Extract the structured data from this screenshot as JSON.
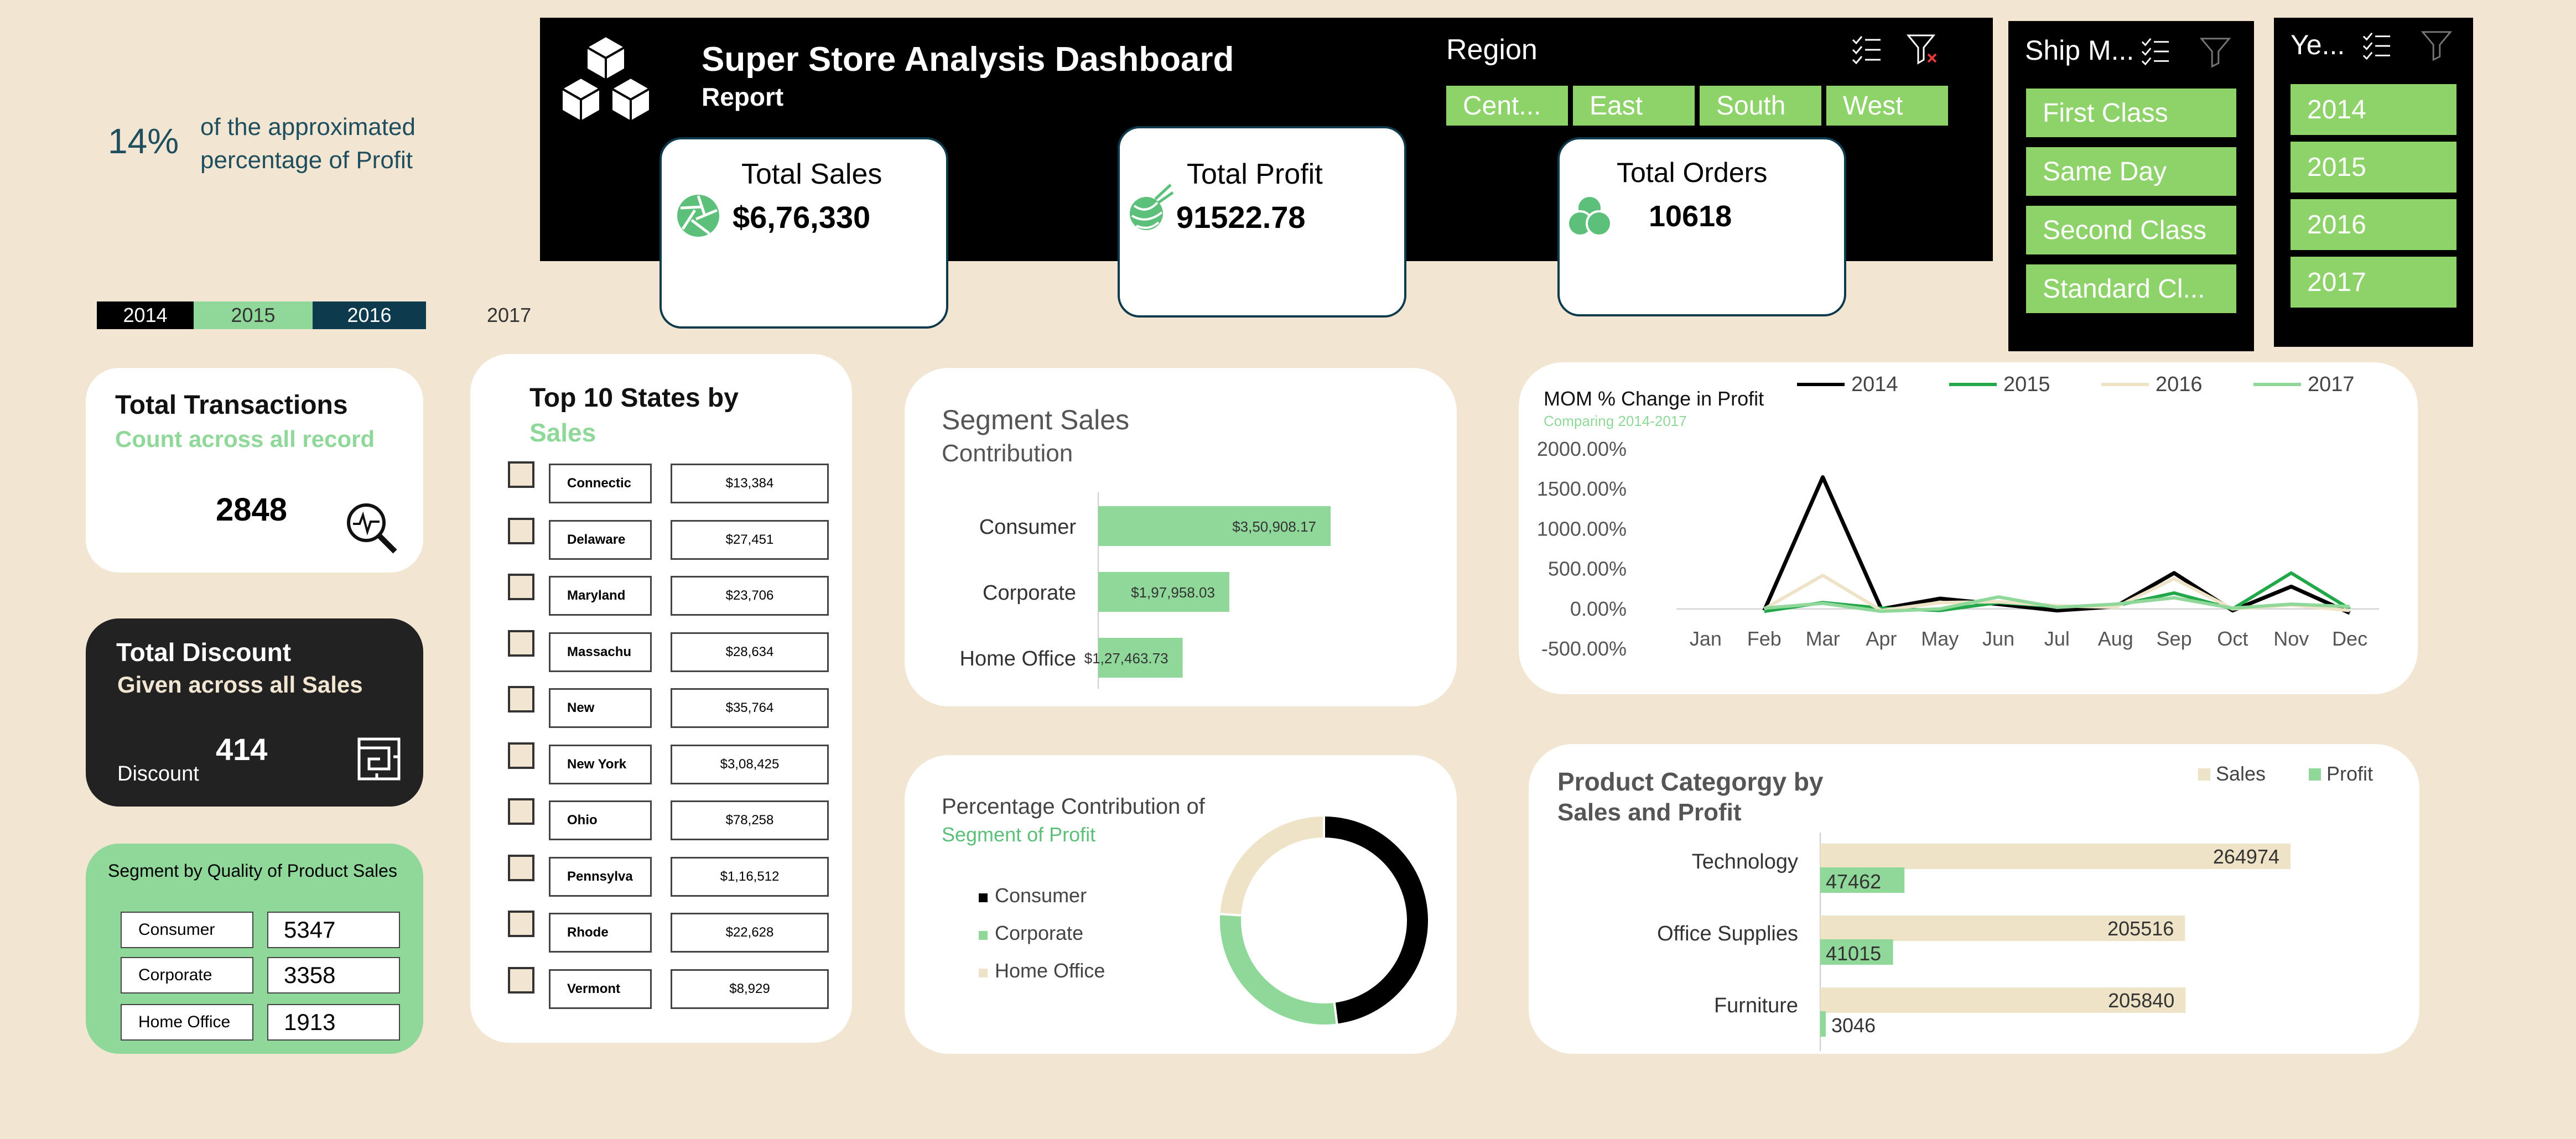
{
  "kpi_left": {
    "percent": "14%",
    "desc_line1": "of the approximated",
    "desc_line2": "percentage of Profit"
  },
  "year_strip": [
    "2014",
    "2015",
    "2016",
    "2017"
  ],
  "header": {
    "title": "Super Store Analysis Dashboard",
    "subtitle": "Report"
  },
  "region": {
    "title": "Region",
    "items": [
      "Cent...",
      "East",
      "South",
      "West"
    ]
  },
  "ship_mode": {
    "title": "Ship M...",
    "items": [
      "First Class",
      "Same Day",
      "Second Class",
      "Standard Cl..."
    ]
  },
  "year_slicer": {
    "title": "Ye...",
    "items": [
      "2014",
      "2015",
      "2016",
      "2017"
    ]
  },
  "kpis": {
    "sales": {
      "label": "Total Sales",
      "value": "$6,76,330"
    },
    "profit": {
      "label": "Total Profit",
      "value": "91522.78"
    },
    "orders": {
      "label": "Total Orders",
      "value": "10618"
    }
  },
  "transactions": {
    "title": "Total Transactions",
    "subtitle": "Count across all record",
    "value": "2848"
  },
  "discount": {
    "title": "Total Discount",
    "subtitle": "Given across all Sales",
    "label": "Discount",
    "value": "414"
  },
  "segment_quality": {
    "title": "Segment by Quality of Product Sales",
    "rows": [
      {
        "label": "Consumer",
        "value": "5347"
      },
      {
        "label": "Corporate",
        "value": "3358"
      },
      {
        "label": "Home Office",
        "value": "1913"
      }
    ]
  },
  "top_states": {
    "title_line1": "Top 10 States by",
    "title_line2": "Sales",
    "rows": [
      {
        "state": "Connectic",
        "sales": "$13,384"
      },
      {
        "state": "Delaware",
        "sales": "$27,451"
      },
      {
        "state": "Maryland",
        "sales": "$23,706"
      },
      {
        "state": "Massachu",
        "sales": "$28,634"
      },
      {
        "state": "New",
        "sales": "$35,764"
      },
      {
        "state": "New York",
        "sales": "$3,08,425"
      },
      {
        "state": "Ohio",
        "sales": "$78,258"
      },
      {
        "state": "Pennsylva",
        "sales": "$1,16,512"
      },
      {
        "state": "Rhode",
        "sales": "$22,628"
      },
      {
        "state": "Vermont",
        "sales": "$8,929"
      }
    ]
  },
  "colors": {
    "bg": "#f2e6d3",
    "green": "#8ed26a",
    "bar_green": "#8fd89a",
    "dark": "#000000",
    "cream": "#f2e6d3",
    "teal": "#0e3a4d"
  },
  "chart_data": [
    {
      "type": "bar",
      "title": "Segment Sales",
      "subtitle": "Contribution",
      "categories": [
        "Consumer",
        "Corporate",
        "Home Office"
      ],
      "values": [
        350908.17,
        197958.03,
        127463.73
      ],
      "value_labels": [
        "$3,50,908.17",
        "$1,97,958.03",
        "$1,27,463.73"
      ],
      "orientation": "horizontal"
    },
    {
      "type": "line",
      "title": "MOM % Change in Profit",
      "subtitle": "Comparing 2014-2017",
      "categories": [
        "Jan",
        "Feb",
        "Mar",
        "Apr",
        "May",
        "Jun",
        "Jul",
        "Aug",
        "Sep",
        "Oct",
        "Nov",
        "Dec"
      ],
      "y_ticks": [
        "2000.00%",
        "1500.00%",
        "1000.00%",
        "500.00%",
        "0.00%",
        "-500.00%"
      ],
      "ylim": [
        -500,
        2000
      ],
      "legend_position": "top",
      "series": [
        {
          "name": "2014",
          "color": "#000000",
          "values": [
            null,
            -20,
            1650,
            0,
            130,
            60,
            -20,
            30,
            450,
            -20,
            280,
            -50
          ]
        },
        {
          "name": "2015",
          "color": "#22a84a",
          "values": [
            null,
            -30,
            80,
            10,
            -20,
            80,
            30,
            40,
            200,
            0,
            450,
            0
          ]
        },
        {
          "name": "2016",
          "color": "#efe3c7",
          "values": [
            null,
            0,
            420,
            -20,
            80,
            90,
            40,
            20,
            380,
            0,
            50,
            -20
          ]
        },
        {
          "name": "2017",
          "color": "#8fd89a",
          "values": [
            null,
            10,
            70,
            -30,
            0,
            150,
            20,
            60,
            140,
            10,
            60,
            30
          ]
        }
      ]
    },
    {
      "type": "pie",
      "title": "Percentage Contribution of",
      "subtitle": "Segment of Profit",
      "categories": [
        "Consumer",
        "Corporate",
        "Home Office"
      ],
      "values": [
        48,
        28,
        24
      ],
      "colors": [
        "#000000",
        "#8fd89a",
        "#efe3c7"
      ],
      "legend_position": "left"
    },
    {
      "type": "bar",
      "title": "Product Categorgy by",
      "subtitle": "Sales and Profit",
      "orientation": "horizontal",
      "categories": [
        "Technology",
        "Office Supplies",
        "Furniture"
      ],
      "legend_position": "top-right",
      "series": [
        {
          "name": "Sales",
          "color": "#efe3c7",
          "values": [
            264974,
            205516,
            205840
          ]
        },
        {
          "name": "Profit",
          "color": "#8fd89a",
          "values": [
            47462,
            41015,
            3046
          ]
        }
      ]
    }
  ]
}
